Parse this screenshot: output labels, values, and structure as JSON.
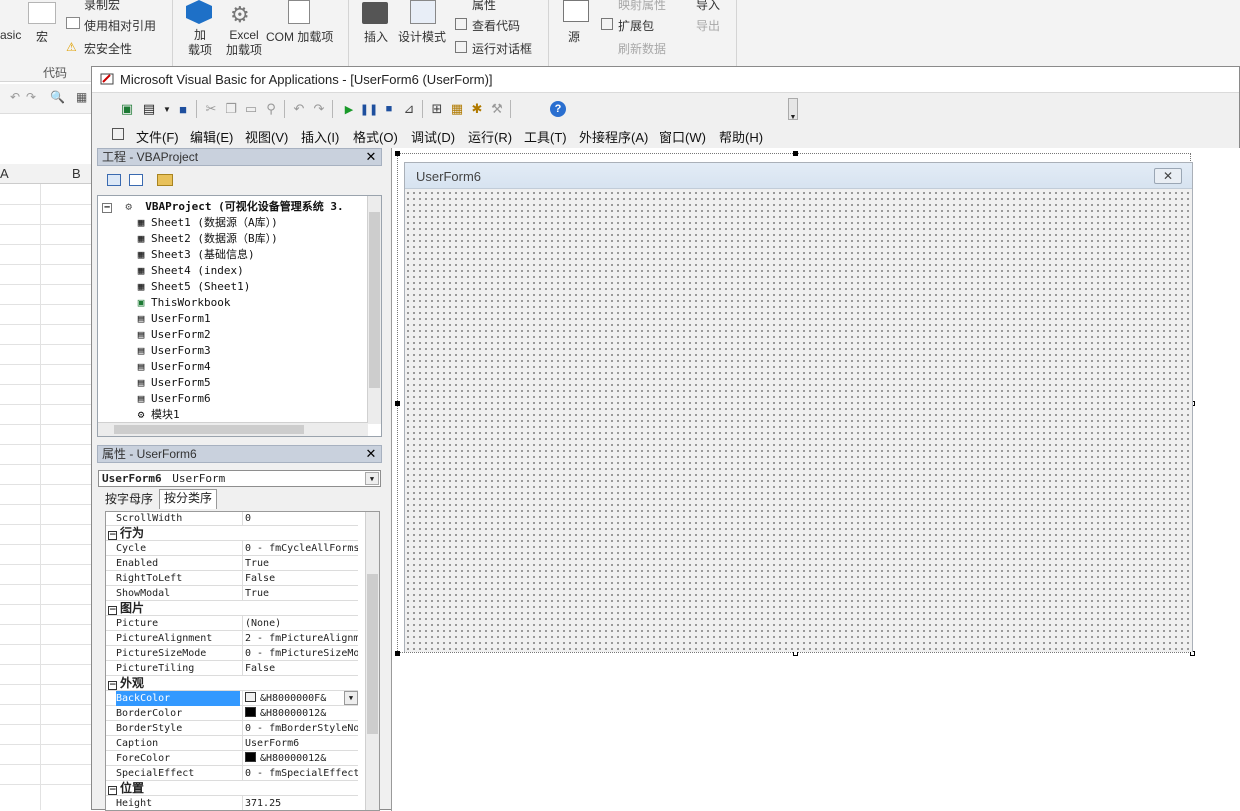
{
  "ribbon": {
    "basic_label": "asic",
    "macro_label": "宏",
    "record_macro": "录制宏",
    "relative_ref": "使用相对引用",
    "macro_security": "宏安全性",
    "code_group": "代码",
    "addins_label": "加\n载项",
    "excel_addins": "Excel\n加载项",
    "com_addins": "COM 加载项",
    "insert_label": "插入",
    "design_mode": "设计模式",
    "properties": "属性",
    "view_code": "查看代码",
    "run_dialog": "运行对话框",
    "source_label": "源",
    "map_props": "映射属性",
    "expansion_pack": "扩展包",
    "refresh_data": "刷新数据",
    "import_label": "导入",
    "export_label": "导出"
  },
  "excel": {
    "col_a": "A",
    "col_b": "B"
  },
  "vba": {
    "title": "Microsoft Visual Basic for Applications - [UserForm6 (UserForm)]",
    "menu": [
      "文件(F)",
      "编辑(E)",
      "视图(V)",
      "插入(I)",
      "格式(O)",
      "调试(D)",
      "运行(R)",
      "工具(T)",
      "外接程序(A)",
      "窗口(W)",
      "帮助(H)"
    ],
    "project": {
      "title": "工程 - VBAProject",
      "root": "VBAProject (可视化设备管理系统 3.",
      "items": [
        {
          "label": "Sheet1 (数据源（A库）)",
          "icon": "sheet-icon"
        },
        {
          "label": "Sheet2 (数据源（B库）)",
          "icon": "sheet-icon"
        },
        {
          "label": "Sheet3 (基础信息)",
          "icon": "sheet-icon"
        },
        {
          "label": "Sheet4 (index)",
          "icon": "sheet-icon"
        },
        {
          "label": "Sheet5 (Sheet1)",
          "icon": "sheet-icon"
        },
        {
          "label": "ThisWorkbook",
          "icon": "workbook-icon"
        },
        {
          "label": "UserForm1",
          "icon": "form-icon"
        },
        {
          "label": "UserForm2",
          "icon": "form-icon"
        },
        {
          "label": "UserForm3",
          "icon": "form-icon"
        },
        {
          "label": "UserForm4",
          "icon": "form-icon"
        },
        {
          "label": "UserForm5",
          "icon": "form-icon"
        },
        {
          "label": "UserForm6",
          "icon": "form-icon"
        },
        {
          "label": "模块1",
          "icon": "module-icon"
        }
      ]
    },
    "properties": {
      "title": "属性 - UserForm6",
      "object_name": "UserForm6",
      "object_type": "UserForm",
      "tab_alpha": "按字母序",
      "tab_category": "按分类序",
      "rows": [
        {
          "name": "ScrollWidth",
          "value": "0"
        },
        {
          "cat": "行为"
        },
        {
          "name": "Cycle",
          "value": "0 - fmCycleAllForms"
        },
        {
          "name": "Enabled",
          "value": "True"
        },
        {
          "name": "RightToLeft",
          "value": "False"
        },
        {
          "name": "ShowModal",
          "value": "True"
        },
        {
          "cat": "图片"
        },
        {
          "name": "Picture",
          "value": "(None)"
        },
        {
          "name": "PictureAlignment",
          "value": "2 - fmPictureAlignm"
        },
        {
          "name": "PictureSizeMode",
          "value": "0 - fmPictureSizeMo"
        },
        {
          "name": "PictureTiling",
          "value": "False"
        },
        {
          "cat": "外观"
        },
        {
          "name": "BackColor",
          "value": "&H8000000F&",
          "swatch": "#f0f0f0",
          "selected": true
        },
        {
          "name": "BorderColor",
          "value": "&H80000012&",
          "swatch": "#000000"
        },
        {
          "name": "BorderStyle",
          "value": "0 - fmBorderStyleNo"
        },
        {
          "name": "Caption",
          "value": "UserForm6"
        },
        {
          "name": "ForeColor",
          "value": "&H80000012&",
          "swatch": "#000000"
        },
        {
          "name": "SpecialEffect",
          "value": "0 - fmSpecialEffect"
        },
        {
          "cat": "位置"
        },
        {
          "name": "Height",
          "value": "371.25"
        }
      ]
    },
    "designer": {
      "caption": "UserForm6",
      "close_glyph": "✕"
    }
  }
}
